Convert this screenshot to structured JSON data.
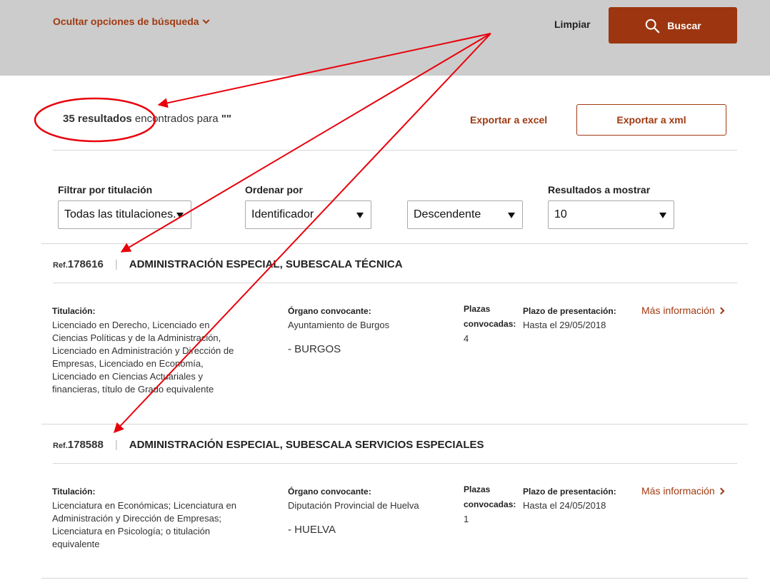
{
  "header": {
    "toggle_label": "Ocultar opciones de búsqueda",
    "clear_label": "Limpiar",
    "search_label": "Buscar"
  },
  "results": {
    "count": "35 resultados",
    "suffix": " encontrados para ",
    "query": "\"\"",
    "export_excel": "Exportar a excel",
    "export_xml": "Exportar a xml"
  },
  "filters": {
    "titulacion_label": "Filtrar por titulación",
    "titulacion_value": "Todas las titulaciones.",
    "ordenar_label": "Ordenar por",
    "ordenar_value": "Identificador",
    "direccion_value": "Descendente",
    "mostrar_label": "Resultados a mostrar",
    "mostrar_value": "10"
  },
  "labels": {
    "ref_prefix": "Ref.",
    "titulacion": "Titulación:",
    "organo": "Órgano convocante:",
    "plazas_1": "Plazas",
    "plazas_2": "convocadas:",
    "plazo": "Plazo de presentación:",
    "more": "Más información"
  },
  "items": [
    {
      "ref": "178616",
      "title": "ADMINISTRACIÓN ESPECIAL, SUBESCALA TÉCNICA",
      "titulacion_lines": [
        "Licenciado en Derecho, Licenciado en",
        "Ciencias Políticas y de la Administración,",
        "Licenciado en Administración y Dirección de",
        "Empresas, Licenciado en Economía,",
        "Licenciado en Ciencias Actuariales y",
        "financieras, título de Grado equivalente"
      ],
      "organo": "Ayuntamiento de Burgos",
      "provincia": "- BURGOS",
      "plazas": "4",
      "plazo": "Hasta el 29/05/2018"
    },
    {
      "ref": "178588",
      "title": "ADMINISTRACIÓN ESPECIAL, SUBESCALA SERVICIOS ESPECIALES",
      "titulacion_lines": [
        "Licenciatura en Económicas; Licenciatura en",
        "Administración y Dirección de Empresas;",
        "Licenciatura en Psicología; o titulación",
        "equivalente"
      ],
      "organo": "Diputación Provincial de Huelva",
      "provincia": "- HUELVA",
      "plazas": "1",
      "plazo": "Hasta el 24/05/2018"
    }
  ],
  "colors": {
    "accent": "#9d3610",
    "link": "#a03a12",
    "annotation": "#e8000b",
    "header_bg": "#cccccc"
  }
}
